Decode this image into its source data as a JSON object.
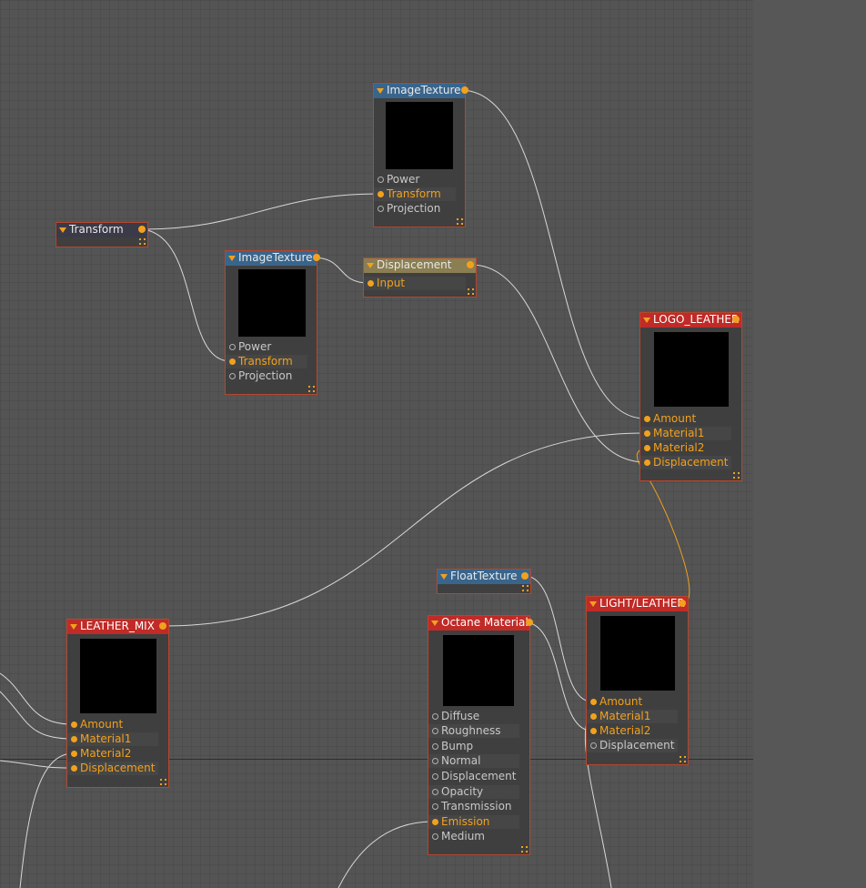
{
  "nodes": {
    "imagetexture_top": {
      "title": "ImageTexture",
      "pins": [
        "Power",
        "Transform",
        "Projection"
      ]
    },
    "transform": {
      "title": "Transform"
    },
    "imagetexture_mid": {
      "title": "ImageTexture",
      "pins": [
        "Power",
        "Transform",
        "Projection"
      ]
    },
    "displacement": {
      "title": "Displacement",
      "pins": [
        "Input"
      ]
    },
    "logo_leather": {
      "title": "LOGO_LEATHER",
      "pins": [
        "Amount",
        "Material1",
        "Material2",
        "Displacement"
      ]
    },
    "floattexture": {
      "title": "FloatTexture"
    },
    "light_leather": {
      "title": "LIGHT/LEATHER",
      "pins": [
        "Amount",
        "Material1",
        "Material2",
        "Displacement"
      ]
    },
    "leather_mix": {
      "title": "LEATHER_MIX",
      "pins": [
        "Amount",
        "Material1",
        "Material2",
        "Displacement"
      ]
    },
    "octane_material": {
      "title": "Octane Material",
      "pins": [
        "Diffuse",
        "Roughness",
        "Bump",
        "Normal",
        "Displacement",
        "Opacity",
        "Transmission",
        "Emission",
        "Medium"
      ]
    }
  },
  "colors": {
    "background": "#545454",
    "accent_orange": "#f2a11d",
    "header_blue": "#39658c",
    "header_red": "#c02b27",
    "header_khaki": "#8a7e52",
    "node_border": "#b5472d"
  }
}
